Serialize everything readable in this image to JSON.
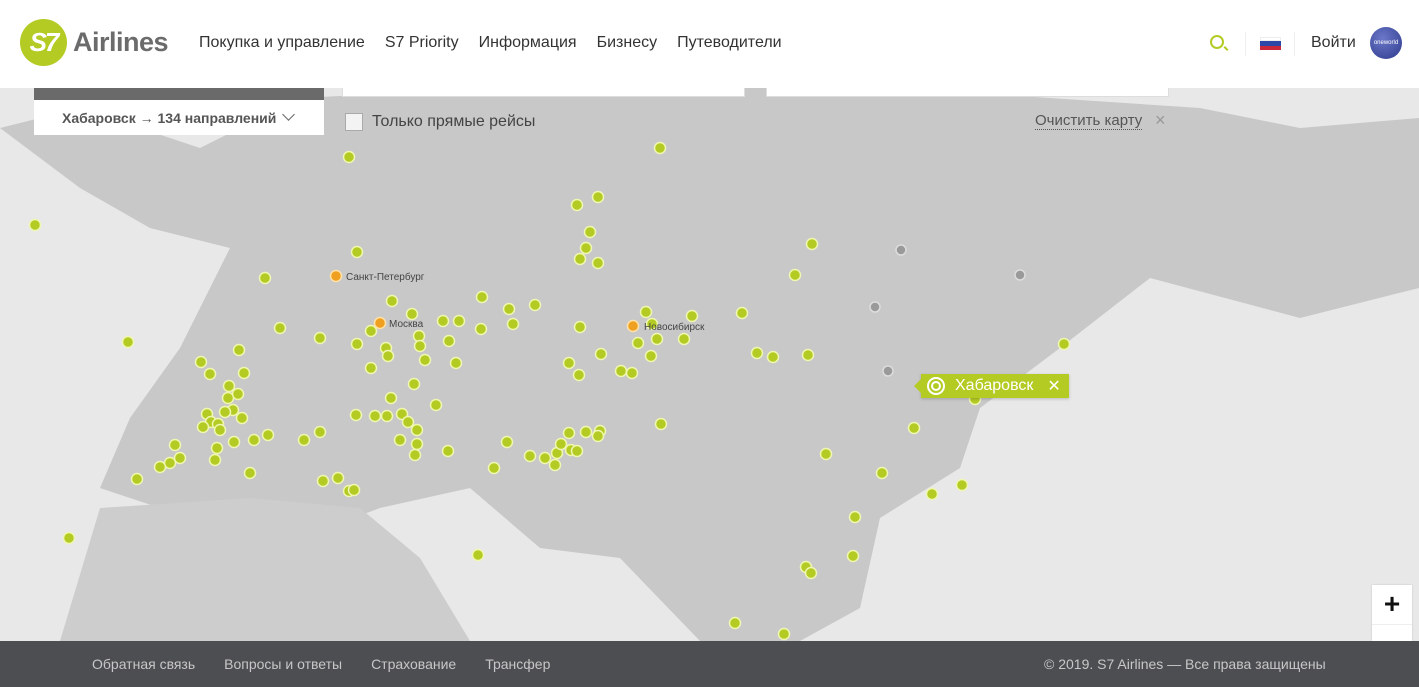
{
  "header": {
    "logo_mark": "S7",
    "logo_text": "Airlines",
    "nav": [
      "Покупка и управление",
      "S7 Priority",
      "Информация",
      "Бизнесу",
      "Путеводители"
    ],
    "login": "Войти",
    "oneworld": "oneworld",
    "icons": [
      "search-icon",
      "flag-russia-icon"
    ]
  },
  "map": {
    "direction_selector": "Хабаровск → 134 направлений",
    "direct_only_label": "Только прямые рейсы",
    "direct_only_checked": false,
    "clear_map": "Очистить карту",
    "hub_labels": [
      "Санкт-Петербург",
      "Москва",
      "Новосибирск"
    ],
    "selected_city": "Хабаровск",
    "zoom_in": "+",
    "colors": {
      "accent": "#b4cb24",
      "hub": "#f0a020",
      "inactive": "#9a9a9a"
    }
  },
  "footer": {
    "links": [
      "Обратная связь",
      "Вопросы и ответы",
      "Страхование",
      "Трансфер"
    ],
    "copyright": "© 2019. S7 Airlines — Все права защищены"
  }
}
